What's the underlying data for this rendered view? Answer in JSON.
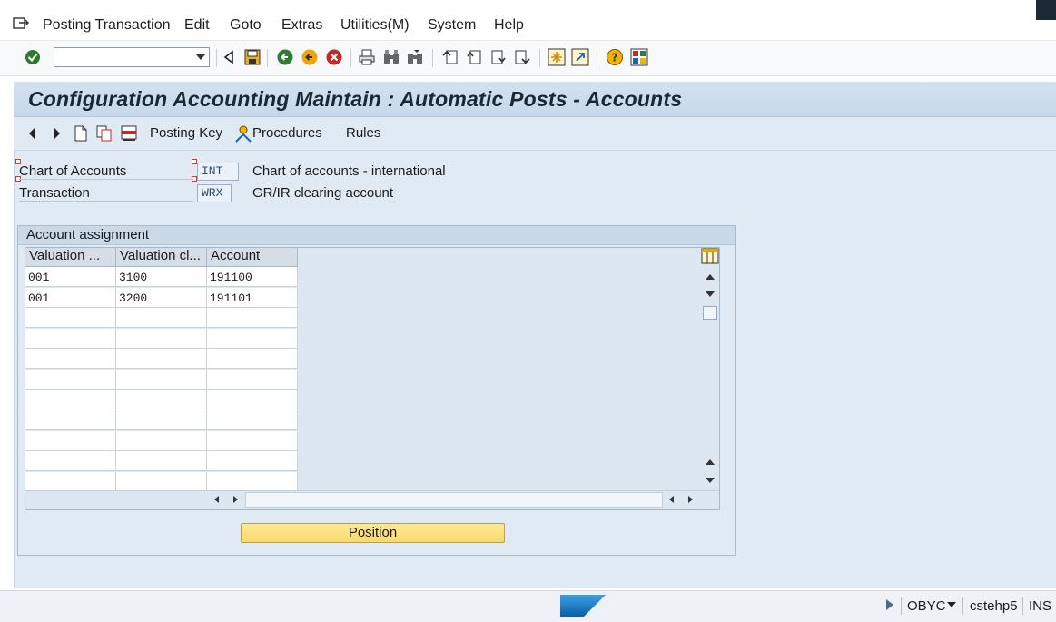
{
  "menu": {
    "items": [
      "Posting Transaction",
      "Edit",
      "Goto",
      "Extras",
      "Utilities(M)",
      "System",
      "Help"
    ]
  },
  "toolbar": {
    "command_field_value": "",
    "icons": [
      "enter-icon",
      "back-icon",
      "save-icon",
      "exit-icon",
      "end-icon",
      "cancel-icon",
      "print-icon",
      "find-icon",
      "find-next-icon",
      "first-page-icon",
      "previous-page-icon",
      "next-page-icon",
      "last-page-icon",
      "create-session-icon",
      "shortcut-icon",
      "help-icon",
      "layout-icon"
    ]
  },
  "page": {
    "title": "Configuration Accounting Maintain : Automatic Posts - Accounts"
  },
  "app_toolbar": {
    "posting_key": "Posting Key",
    "procedures": "Procedures",
    "rules": "Rules"
  },
  "fields": {
    "chart_of_accounts": {
      "label": "Chart of Accounts",
      "value": "INT",
      "description": "Chart of accounts - international"
    },
    "transaction": {
      "label": "Transaction",
      "value": "WRX",
      "description": "GR/IR clearing account"
    }
  },
  "account_assignment": {
    "title": "Account assignment",
    "columns": [
      "Valuation ...",
      "Valuation cl...",
      "Account"
    ],
    "rows": [
      [
        "001",
        "3100",
        "191100"
      ],
      [
        "001",
        "3200",
        "191101"
      ]
    ],
    "position_button": "Position"
  },
  "status": {
    "transaction": "OBYC",
    "server": "cstehp5",
    "mode": "INS"
  },
  "colors": {
    "accent": "#dfeaf4",
    "title_bar": "#c6d8ea",
    "position_button": "#f8d96c"
  }
}
